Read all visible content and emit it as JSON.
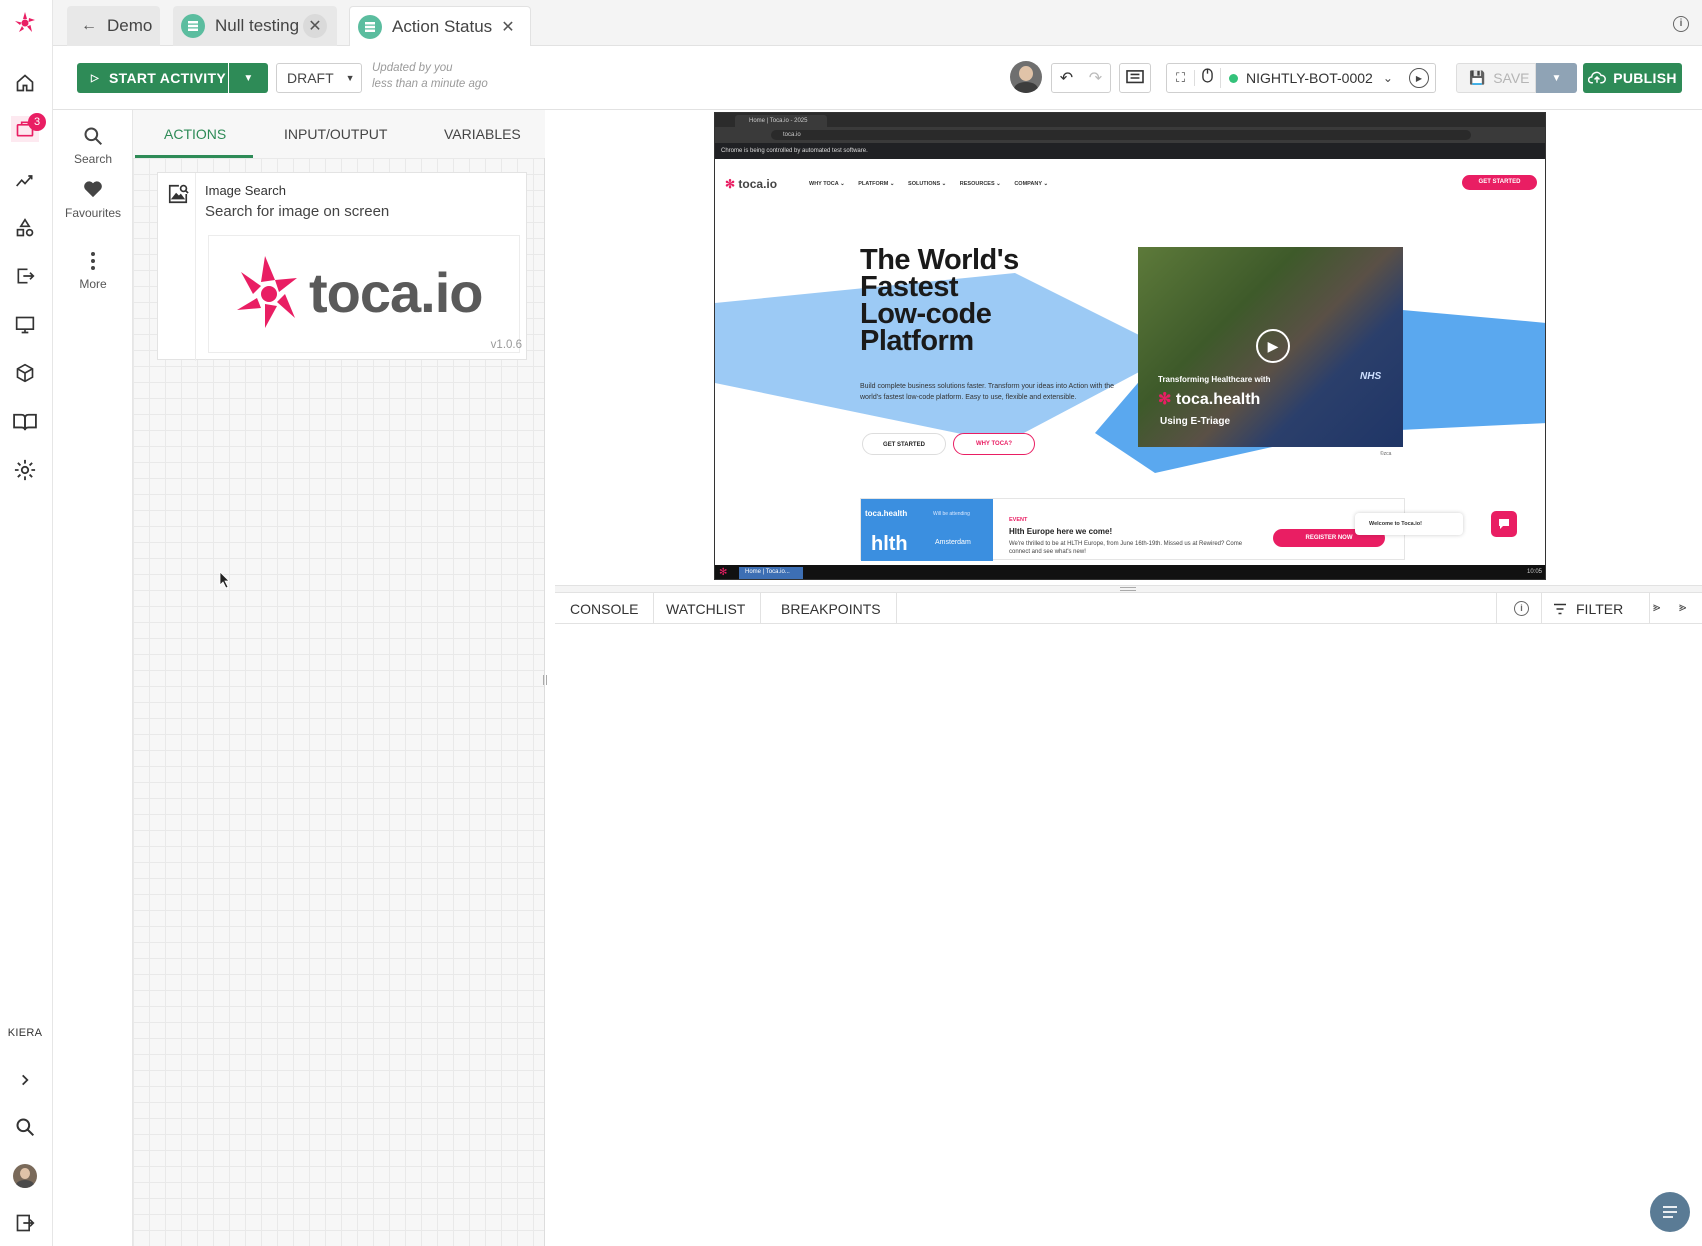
{
  "rail": {
    "notifications_count": "3",
    "user_label": "KIERA",
    "items": [
      "home-icon",
      "projects-icon",
      "analytics-icon",
      "shapes-icon",
      "export-icon",
      "monitor-icon",
      "package-icon",
      "book-icon",
      "settings-icon"
    ]
  },
  "tabs": [
    {
      "label": "Demo",
      "icon": "arrow-left-icon",
      "closable": false
    },
    {
      "label": "Null testing",
      "icon": "stack-icon",
      "closable": true
    },
    {
      "label": "Action Status",
      "icon": "stack-icon",
      "closable": true
    }
  ],
  "toolbar": {
    "start_label": "START ACTIVITY",
    "draft_label": "DRAFT",
    "status_line1": "Updated by you",
    "status_line2": "less than a minute ago",
    "bot_name": "NIGHTLY-BOT-0002",
    "save_label": "SAVE",
    "publish_label": "PUBLISH",
    "accent": "#2e8b57",
    "bot_status_color": "#34c27a"
  },
  "categories": [
    {
      "label": "Search",
      "icon": "search-icon"
    },
    {
      "label": "Favourites",
      "icon": "heart-icon"
    },
    {
      "label": "More",
      "icon": "more-vertical-icon"
    }
  ],
  "panel": {
    "tabs": [
      "ACTIONS",
      "INPUT/OUTPUT",
      "VARIABLES"
    ],
    "active_tab": "ACTIONS",
    "card": {
      "title": "Image Search",
      "description": "Search for image on screen",
      "image_text": "toca.io",
      "version": "v1.0.6"
    }
  },
  "preview": {
    "browser_tab": "Home | Toca.io - 2025",
    "url": "toca.io",
    "info_bar": "Chrome is being controlled by automated test software.",
    "site_logo": "toca.io",
    "nav": [
      "WHY TOCA ⌄",
      "PLATFORM ⌄",
      "SOLUTIONS ⌄",
      "RESOURCES ⌄",
      "COMPANY ⌄"
    ],
    "cta_top": "GET STARTED",
    "hero_lines": [
      "The World's",
      "Fastest",
      "Low-code",
      "Platform"
    ],
    "hero_sub": "Build complete business solutions faster. Transform your ideas into Action with the world's fastest low-code platform. Easy to use, flexible and extensible.",
    "btn_get_started": "GET STARTED",
    "btn_why": "WHY TOCA?",
    "video_line1": "Transforming Healthcare with",
    "video_brand": "toca.health",
    "video_line2": "Using E-Triage",
    "video_badge": "NHS",
    "video_caption": "©zca",
    "event_tag": "EVENT",
    "event_title": "Hlth Europe here we come!",
    "event_text": "We're thrilled to be at HLTH Europe, from June 16th-19th. Missed us at Rewired? Come connect and see what's new!",
    "event_btn": "REGISTER NOW",
    "event_card_brand": "toca.health",
    "event_card_sub": "Will be attending",
    "event_card_logo": "hlth",
    "event_card_city": "Amsterdam",
    "chat_text": "Welcome to Toca.io!",
    "taskbar_item": "Home | Toca.io...",
    "clock": "10:05"
  },
  "console": {
    "tabs": [
      "CONSOLE",
      "WATCHLIST",
      "BREAKPOINTS"
    ],
    "filter_label": "FILTER"
  }
}
